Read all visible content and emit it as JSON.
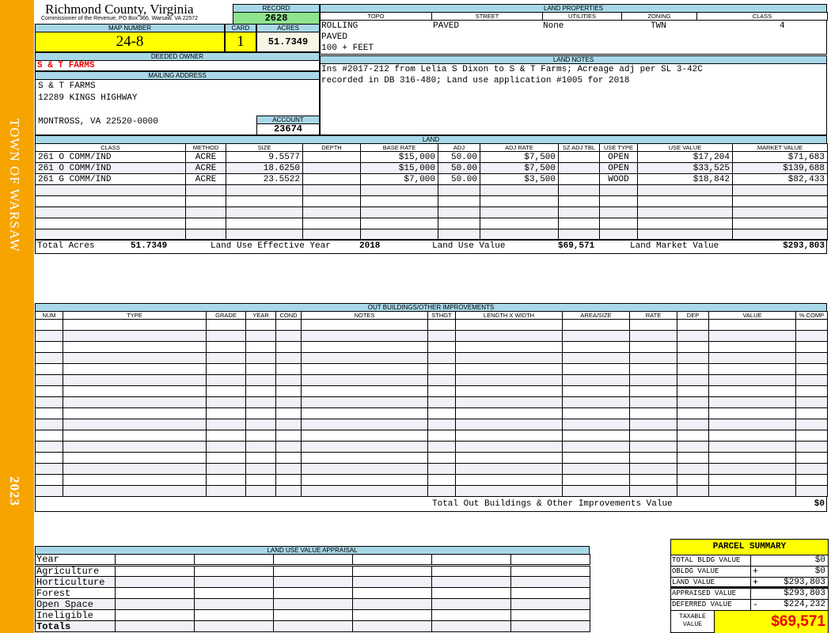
{
  "side": {
    "town": "TOWN OF WARSAW",
    "year": "2023"
  },
  "header": {
    "title": "Richmond County, Virginia",
    "subtitle": "Commissioner of the Revenue, PO Box 366, Warsaw, VA 22572",
    "record_label": "RECORD",
    "record": "2628"
  },
  "parcel": {
    "map_label": "MAP NUMBER",
    "map": "24-8",
    "card_label": "CARD",
    "card": "1",
    "acres_label": "ACRES",
    "acres": "51.7349",
    "owner_label": "DEEDED OWNER",
    "owner": "S & T FARMS",
    "mailing_label": "MAILING ADDRESS",
    "address": [
      "S & T FARMS",
      "12289 KINGS HIGHWAY",
      "MONTROSS, VA 22520-0000"
    ],
    "account_label": "ACCOUNT",
    "account": "23674"
  },
  "land_props": {
    "label": "LAND PROPERTIES",
    "headers": [
      "TOPO",
      "STREET",
      "UTILITIES",
      "ZONING",
      "CLASS"
    ],
    "topo": [
      "ROLLING",
      "PAVED",
      "100 + FEET"
    ],
    "street": "PAVED",
    "utilities": "None",
    "zoning": "TWN",
    "class": "4"
  },
  "land_notes": {
    "label": "LAND NOTES",
    "lines": [
      "Ins #2017-212 from Lelia S Dixon to S & T Farms; Acreage adj per SL 3-42C",
      "recorded in DB 316-480; Land use application #1005 for 2018"
    ]
  },
  "land": {
    "label": "LAND",
    "headers": [
      "CLASS",
      "METHOD",
      "SIZE",
      "DEPTH",
      "BASE RATE",
      "ADJ",
      "ADJ RATE",
      "SZ ADJ TBL",
      "USE TYPE",
      "USE VALUE",
      "MARKET VALUE"
    ],
    "rows": [
      [
        "261 O COMM/IND",
        "ACRE",
        "9.5577",
        "",
        "$15,000",
        "50.00",
        "$7,500",
        "",
        "OPEN",
        "$17,204",
        "$71,683"
      ],
      [
        "261 O COMM/IND",
        "ACRE",
        "18.6250",
        "",
        "$15,000",
        "50.00",
        "$7,500",
        "",
        "OPEN",
        "$33,525",
        "$139,688"
      ],
      [
        "261 G COMM/IND",
        "ACRE",
        "23.5522",
        "",
        "$7,000",
        "50.00",
        "$3,500",
        "",
        "WOOD",
        "$18,842",
        "$82,433"
      ]
    ],
    "totals": {
      "acres_label": "Total Acres",
      "acres": "51.7349",
      "year_label": "Land Use Effective Year",
      "year": "2018",
      "use_label": "Land Use Value",
      "use": "$69,571",
      "market_label": "Land Market Value",
      "market": "$293,803"
    }
  },
  "outbuildings": {
    "label": "OUT BUILDINGS/OTHER IMPROVEMENTS",
    "headers": [
      "NUM",
      "TYPE",
      "GRADE",
      "YEAR",
      "COND",
      "NOTES",
      "STHGT",
      "LENGTH X WIDTH",
      "AREA/SIZE",
      "RATE",
      "DEP",
      "VALUE",
      "% COMP"
    ],
    "total_label": "Total Out Buildings & Other Improvements Value",
    "total": "$0"
  },
  "land_use": {
    "label": "LAND USE VALUE APPRAISAL",
    "year_label": "Year",
    "rows": [
      "Agriculture",
      "Horticulture",
      "Forest",
      "Open Space",
      "Ineligible"
    ],
    "totals_label": "Totals"
  },
  "summary": {
    "title": "PARCEL SUMMARY",
    "rows": [
      {
        "label": "TOTAL BLDG VALUE",
        "sign": "",
        "value": "$0"
      },
      {
        "label": "OBLDG VALUE",
        "sign": "+",
        "value": "$0"
      },
      {
        "label": "LAND VALUE",
        "sign": "+",
        "value": "$293,803"
      },
      {
        "label": "APPRAISED VALUE",
        "sign": "",
        "value": "$293,803"
      },
      {
        "label": "DEFERRED VALUE",
        "sign": "-",
        "value": "$224,232"
      }
    ],
    "taxable_label": "TAXABLE VALUE",
    "taxable": "$69,571"
  }
}
